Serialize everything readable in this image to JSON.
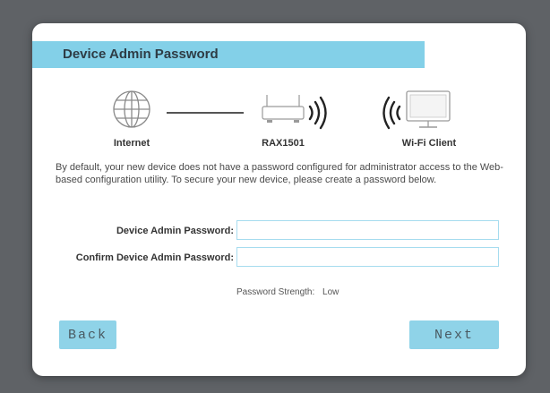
{
  "dialog": {
    "title": "Device Admin Password",
    "diagram": {
      "internet_label": "Internet",
      "router_label": "RAX1501",
      "client_label": "Wi-Fi Client"
    },
    "description": "By default, your new device does not have a password configured for administrator access to the Web-based configuration utility. To secure your new device, please create a password below.",
    "fields": {
      "admin_password_label": "Device Admin Password:",
      "admin_password_value": "",
      "confirm_password_label": "Confirm Device Admin Password:",
      "confirm_password_value": ""
    },
    "strength": {
      "label": "Password Strength:",
      "value": "Low"
    },
    "buttons": {
      "back": "Back",
      "next": "Next"
    }
  },
  "colors": {
    "accent": "#83d0e8",
    "button": "#8fd3e8",
    "input_border": "#a6dcef",
    "backdrop": "#5f6266"
  },
  "icons": [
    "globe-icon",
    "router-icon",
    "wifi-signal-icon",
    "monitor-icon"
  ]
}
